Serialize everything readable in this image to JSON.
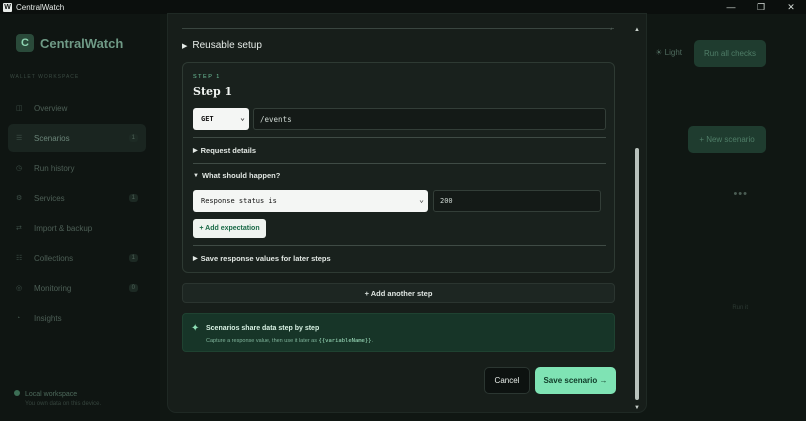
{
  "window": {
    "title": "CentralWatch",
    "app_glyph": "W",
    "controls": {
      "minimize": "—",
      "maximize": "❐",
      "close": "✕"
    }
  },
  "sidebar": {
    "brand": {
      "logo_letter": "C",
      "name": "CentralWatch"
    },
    "workspace_label": "WALLET WORKSPACE",
    "items": [
      {
        "label": "Overview",
        "icon": "grid-icon",
        "glyph": "◫",
        "count": ""
      },
      {
        "label": "Scenarios",
        "icon": "list-icon",
        "glyph": "☰",
        "count": "1"
      },
      {
        "label": "Run history",
        "icon": "clock-icon",
        "glyph": "◷",
        "count": ""
      },
      {
        "label": "Services",
        "icon": "gear-icon",
        "glyph": "⚙",
        "count": "1"
      },
      {
        "label": "Import & backup",
        "icon": "transfer-icon",
        "glyph": "⇄",
        "count": ""
      },
      {
        "label": "Collections",
        "icon": "stack-icon",
        "glyph": "☷",
        "count": "1"
      },
      {
        "label": "Monitoring",
        "icon": "pulse-icon",
        "glyph": "◎",
        "count": "0"
      },
      {
        "label": "Insights",
        "icon": "chart-icon",
        "glyph": "◔",
        "count": ""
      }
    ],
    "active_index": 1,
    "local_workspace": {
      "title": "Local workspace",
      "subtitle": "You own data on this device."
    }
  },
  "background": {
    "light_toggle": "☀ Light",
    "run_all": "Run all checks",
    "new_scenario": "+ New scenario",
    "more": "•••",
    "faint_text": "Run it"
  },
  "modal": {
    "reusable_setup": "Reusable setup",
    "step": {
      "kicker": "STEP 1",
      "title": "Step 1",
      "method": "GET",
      "path": "/events",
      "request_details": "Request details",
      "what_should_happen": "What should happen?",
      "assertion_type": "Response status is",
      "assertion_value": "200",
      "add_expectation": "+ Add expectation",
      "save_response": "Save response values for later steps"
    },
    "add_step": "+ Add another step",
    "info": {
      "title": "Scenarios share data step by step",
      "text": "Capture a response value, then use it later as",
      "code": "{{variableName}}",
      "suffix": "."
    },
    "cancel": "Cancel",
    "save": "Save scenario →"
  },
  "colors": {
    "accent": "#7fe3b4",
    "background": "#111814",
    "modal": "#171e1a",
    "info_bg": "#173528"
  }
}
